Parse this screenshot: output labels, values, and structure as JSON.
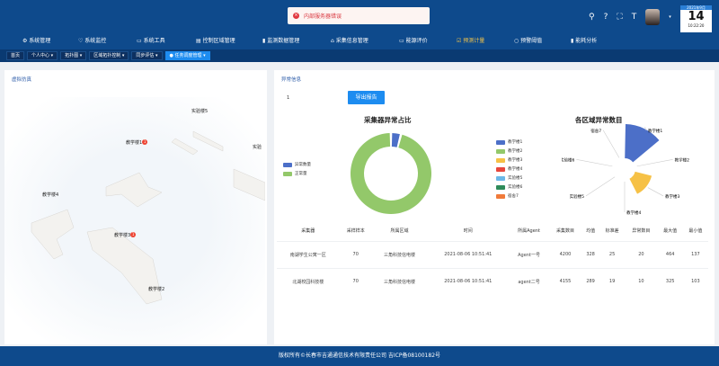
{
  "toast": {
    "text": "内部服务器错误"
  },
  "calendar": {
    "month": "2021年9月",
    "day": "14",
    "time": "10:22:20"
  },
  "nav": [
    {
      "label": "系统管理",
      "icon": "gear-icon"
    },
    {
      "label": "系统监控",
      "icon": "shield-icon"
    },
    {
      "label": "系统工具",
      "icon": "tool-icon"
    },
    {
      "label": "控制区域管理",
      "icon": "doc-icon"
    },
    {
      "label": "监测数据管理",
      "icon": "bar-icon"
    },
    {
      "label": "采集信息管理",
      "icon": "home-icon"
    },
    {
      "label": "能源评价",
      "icon": "monitor-icon"
    },
    {
      "label": "预测计量",
      "icon": "check-icon",
      "active": true
    },
    {
      "label": "预警阈值",
      "icon": "circle-icon"
    },
    {
      "label": "能耗分析",
      "icon": "bar-icon"
    }
  ],
  "tabs": [
    {
      "label": "首页"
    },
    {
      "label": "个人中心"
    },
    {
      "label": "拓扑图"
    },
    {
      "label": "区域拓扑控制"
    },
    {
      "label": "同步评估"
    },
    {
      "label": "任务调度管理",
      "active": true
    }
  ],
  "left": {
    "title": "虚拟仿真",
    "buildings": [
      {
        "label": "实验楼5"
      },
      {
        "label": "教学楼1",
        "alerts": 1
      },
      {
        "label": "实验"
      },
      {
        "label": "教学楼4"
      },
      {
        "label": "教学楼3",
        "alerts": 1
      },
      {
        "label": "教学楼2"
      }
    ]
  },
  "right": {
    "title": "异常信息",
    "index": "1",
    "export_label": "导出报告",
    "donut": {
      "title": "采集器异常占比",
      "legend": [
        "异常数量",
        "正常量"
      ],
      "colors": [
        "#4c6fc8",
        "#93c86a"
      ]
    },
    "rose": {
      "title": "各区域异常数目",
      "legend": [
        "教学楼1",
        "教学楼2",
        "教学楼3",
        "教学楼4",
        "实验楼5",
        "实验楼6",
        "宿舍7"
      ],
      "colors": [
        "#4c6fc8",
        "#93c86a",
        "#f6c146",
        "#e8473c",
        "#6bb8e8",
        "#2e8b5a",
        "#f07a3a"
      ]
    }
  },
  "chart_data": [
    {
      "type": "pie",
      "title": "采集器异常占比",
      "labels": [
        "异常数量",
        "正常量"
      ],
      "values": [
        4,
        96
      ],
      "legend": "left"
    },
    {
      "type": "pie",
      "title": "各区域异常数目",
      "labels": [
        "教学楼1",
        "教学楼2",
        "教学楼3",
        "教学楼4",
        "实验楼5",
        "实验楼6",
        "宿舍7"
      ],
      "values": [
        20,
        0,
        10,
        0,
        0,
        0,
        0
      ],
      "rose": true,
      "legend": "left"
    }
  ],
  "table": {
    "headers": [
      "采集器",
      "采样样本",
      "所属区域",
      "时间",
      "所属Agent",
      "采集数目",
      "均值",
      "标准差",
      "异常数目",
      "最大值",
      "最小值"
    ],
    "rows": [
      [
        "南湖学生公寓一区",
        "70",
        "三角科技信电楼",
        "2021-08-06 10:51:41",
        "Agent一号",
        "4200",
        "328",
        "25",
        "20",
        "464",
        "137"
      ],
      [
        "北湖校园科技楼",
        "70",
        "三角科技信电楼",
        "2021-08-06 10:51:41",
        "agent二号",
        "4155",
        "289",
        "19",
        "10",
        "325",
        "103"
      ]
    ]
  },
  "footer": "版权所有©长春市吉通通信技术有限责任公司 吉ICP备08100182号"
}
